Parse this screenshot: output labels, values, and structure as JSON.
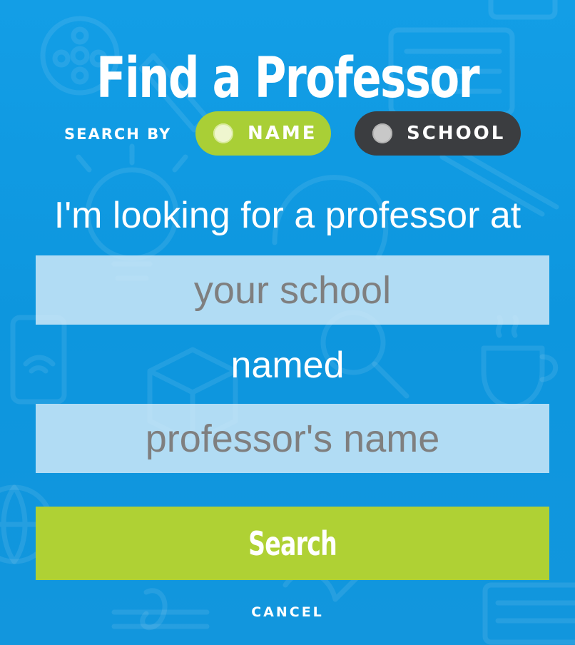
{
  "header": {
    "title": "Find a Professor"
  },
  "search_by": {
    "label": "SEARCH BY",
    "options": [
      {
        "label": "NAME",
        "selected": true
      },
      {
        "label": "SCHOOL",
        "selected": false
      }
    ]
  },
  "form": {
    "prompt_school": "I'm looking for a professor at",
    "school_placeholder": "your school",
    "school_value": "",
    "prompt_name": "named",
    "professor_placeholder": "professor's name",
    "professor_value": ""
  },
  "actions": {
    "search_label": "Search",
    "cancel_label": "CANCEL"
  },
  "colors": {
    "background": "#0d96de",
    "accent_green": "#afd134",
    "toggle_inactive": "#3b3d40"
  }
}
